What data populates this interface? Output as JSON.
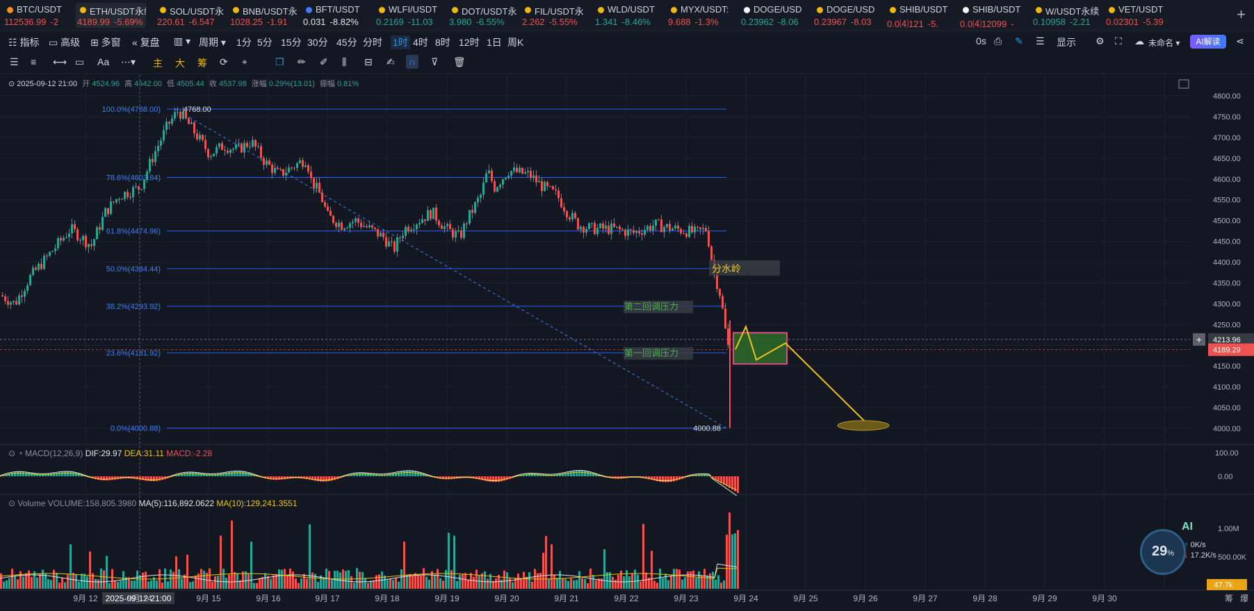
{
  "tabs": [
    {
      "name": "BTC/USDT",
      "price": "112536.99",
      "change": "-2",
      "dir": "dn",
      "color": "#f7931a"
    },
    {
      "name": "ETH/USDT永续",
      "price": "4189.99",
      "change": "-5.69%",
      "dir": "dn",
      "color": "#f0b90b",
      "active": true
    },
    {
      "name": "SOL/USDT永",
      "price": "220.61",
      "change": "-6.547",
      "dir": "dn",
      "color": "#f0b90b"
    },
    {
      "name": "BNB/USDT永",
      "price": "1028.25",
      "change": "-1.91",
      "dir": "dn",
      "color": "#f0b90b"
    },
    {
      "name": "BFT/USDT",
      "price": "0.031",
      "change": "-8.82%",
      "dir": "wh",
      "color": "#3f7cff"
    },
    {
      "name": "WLFI/USDT",
      "price": "0.2169",
      "change": "-11.03",
      "dir": "up",
      "color": "#f0b90b"
    },
    {
      "name": "DOT/USDT永",
      "price": "3.980",
      "change": "-6.55%",
      "dir": "up",
      "color": "#f0b90b"
    },
    {
      "name": "FIL/USDT永",
      "price": "2.262",
      "change": "-5.55%",
      "dir": "dn",
      "color": "#f0b90b"
    },
    {
      "name": "WLD/USDT",
      "price": "1.341",
      "change": "-8.46%",
      "dir": "up",
      "color": "#f0b90b"
    },
    {
      "name": "MYX/USDT:",
      "price": "9.688",
      "change": "-1.3%",
      "dir": "dn",
      "color": "#f0b90b"
    },
    {
      "name": "DOGE/USD",
      "price": "0.23962",
      "change": "-8.06",
      "dir": "up",
      "color": "#ffffff"
    },
    {
      "name": "DOGE/USD",
      "price": "0.23967",
      "change": "-8.03",
      "dir": "dn",
      "color": "#f0b90b"
    },
    {
      "name": "SHIB/USDT",
      "price": "0.0⑷121",
      "change": "-5.",
      "dir": "dn",
      "color": "#f0b90b"
    },
    {
      "name": "SHIB/USDT",
      "price": "0.0⑷12099",
      "change": "-",
      "dir": "dn",
      "color": "#ffffff"
    },
    {
      "name": "W/USDT永续",
      "price": "0.10958",
      "change": "-2.21",
      "dir": "up",
      "color": "#f0b90b"
    },
    {
      "name": "VET/USDT",
      "price": "0.02301",
      "change": "-5.39",
      "dir": "dn",
      "color": "#f0b90b"
    }
  ],
  "toolbar": {
    "indicator": "指标",
    "advanced": "高级",
    "multiwin": "多窗",
    "replay": "复盘",
    "period": "周期",
    "intervals": [
      "1分",
      "5分",
      "15分",
      "30分",
      "45分",
      "分时",
      "1时",
      "4时",
      "8时",
      "12时",
      "1日",
      "周K"
    ],
    "selected_interval": "1时",
    "zero_s": "0s",
    "display": "显示",
    "unnamed": "未命名",
    "ai": "AI解读"
  },
  "drawbar": {
    "main": "主",
    "big": "大",
    "chip": "筹"
  },
  "ohlc": {
    "date": "2025-09-12 21:00",
    "open_l": "开",
    "open": "4524.96",
    "high_l": "高",
    "high": "4542.00",
    "low_l": "低",
    "low": "4505.44",
    "close_l": "收",
    "close": "4537.98",
    "chg_l": "涨幅",
    "chg": "0.29%(13.01)",
    "amp_l": "振幅",
    "amp": "0.81%"
  },
  "fib_levels": [
    {
      "label": "100.0%(4768.00)",
      "price": 4768.0
    },
    {
      "label": "78.6%(4603.84)",
      "price": 4603.84
    },
    {
      "label": "61.8%(4474.96)",
      "price": 4474.96
    },
    {
      "label": "50.0%(4384.44)",
      "price": 4384.44
    },
    {
      "label": "38.2%(4293.92)",
      "price": 4293.92
    },
    {
      "label": "23.6%(4181.92)",
      "price": 4181.92
    },
    {
      "label": "0.0%(4000.88)",
      "price": 4000.88
    }
  ],
  "annotations": {
    "high": "4768.00",
    "low": "4000.88",
    "watershed": "分水岭",
    "second_resist": "第二回调压力",
    "first_resist": "第一回调压力"
  },
  "price_axis": [
    "4800.00",
    "4750.00",
    "4700.00",
    "4650.00",
    "4600.00",
    "4550.00",
    "4500.00",
    "4450.00",
    "4400.00",
    "4350.00",
    "4300.00",
    "4250.00",
    "4200.00",
    "4150.00",
    "4100.00",
    "4050.00",
    "4000.00"
  ],
  "price_tags": {
    "crosshair": "4213.96",
    "last": "4189.29"
  },
  "macd": {
    "label": "MACD(12,26,9)",
    "dif": "DIF:29.97",
    "dea": "DEA:31.11",
    "macd": "MACD:-2.28",
    "axis": [
      "100.00",
      "0.00"
    ]
  },
  "volume": {
    "label": "Volume",
    "vol": "VOLUME:158,805.3980",
    "ma5": "MA(5):116,892.0622",
    "ma10": "MA(10):129,241.3551",
    "axis_top": "1.00M",
    "axis_mid": "500.00K",
    "last_tag": "47.7k"
  },
  "time_axis": [
    "9月 12",
    "2025-09-12 21:00",
    "9月 14",
    "9月 15",
    "9月 16",
    "9月 17",
    "9月 18",
    "9月 19",
    "9月 20",
    "9月 21",
    "9月 22",
    "9月 23",
    "9月 24",
    "9月 25",
    "9月 26",
    "9月 27",
    "9月 28",
    "9月 29",
    "9月 30"
  ],
  "bottom_right": [
    "筹",
    "爆"
  ],
  "widget": {
    "percent": "29",
    "unit": "%",
    "up": "0",
    "down": "17.2",
    "speed_unit": "K/s",
    "ai": "AI"
  },
  "colors": {
    "up": "#26a69a",
    "down": "#ef5350",
    "fib": "#2962ff",
    "accent": "#2196f3",
    "yellow": "#f0c419"
  }
}
